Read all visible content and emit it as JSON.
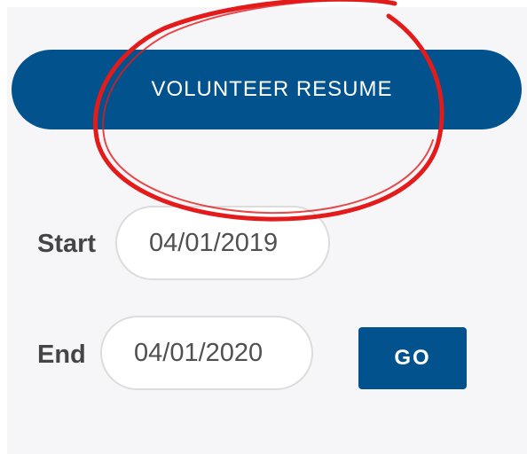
{
  "actions": {
    "resume_label": "VOLUNTEER RESUME",
    "go_label": "GO"
  },
  "filters": {
    "start_label": "Start",
    "start_value": "04/01/2019",
    "end_label": "End",
    "end_value": "04/01/2020"
  },
  "colors": {
    "primary": "#02528d",
    "annotation": "#e31b1b",
    "panel": "#f6f6f9"
  }
}
